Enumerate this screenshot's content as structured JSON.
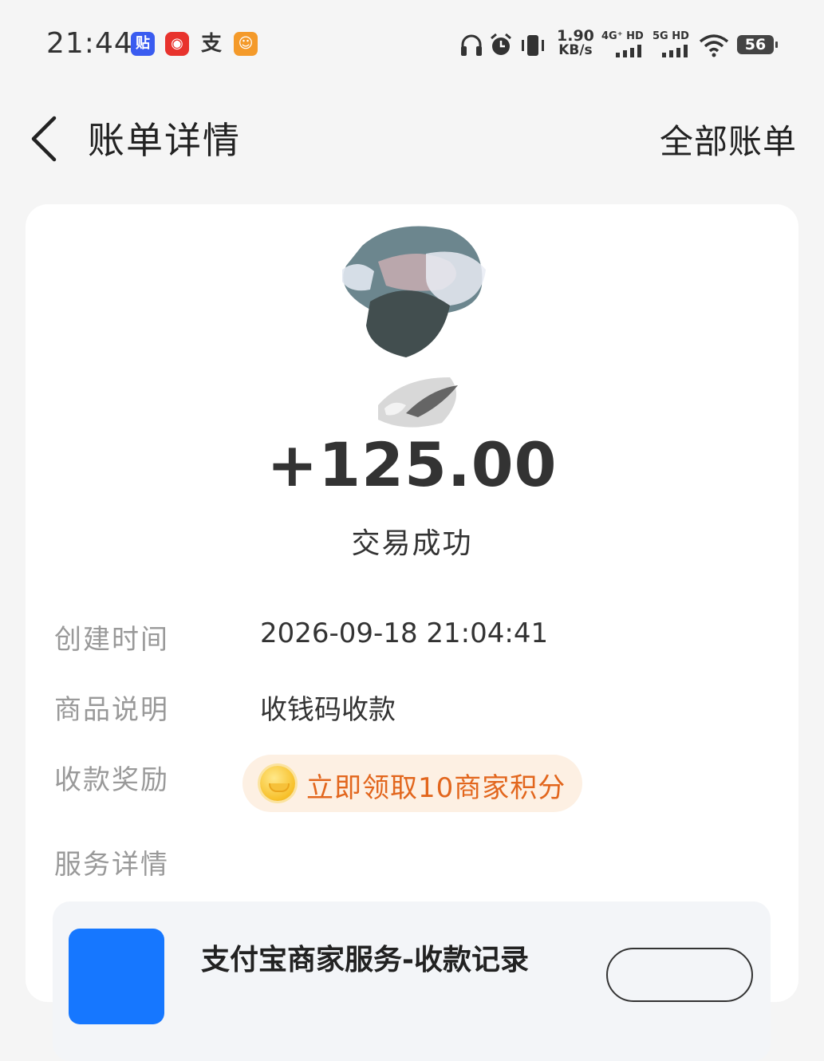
{
  "status_bar": {
    "time": "21:44",
    "apps": [
      {
        "icon": "tieba-icon",
        "glyph": "贴",
        "color": "#3a5cf0"
      },
      {
        "icon": "netease-music-icon",
        "glyph": "◉",
        "color": "#e8332d"
      },
      {
        "icon": "alipay-notify-icon",
        "glyph": "支",
        "color": "#ffffff"
      },
      {
        "icon": "game-app-icon",
        "glyph": "☺",
        "color": "#f49a2a"
      }
    ],
    "speed_value": "1.90",
    "speed_unit": "KB/s",
    "sig1": "4G⁺ HD",
    "sig2": "5G HD",
    "battery": "56"
  },
  "nav": {
    "title": "账单详情",
    "all_bills": "全部账单"
  },
  "detail": {
    "amount": "+125.00",
    "status": "交易成功",
    "rows": [
      {
        "label": "创建时间",
        "value": "2026-09-18 21:04:41"
      },
      {
        "label": "商品说明",
        "value": "收钱码收款"
      },
      {
        "label": "收款奖励",
        "value": ""
      },
      {
        "label": "服务详情",
        "value": ""
      }
    ],
    "reward_text": "立即领取10商家积分",
    "service_title": "支付宝商家服务-收款记录"
  }
}
